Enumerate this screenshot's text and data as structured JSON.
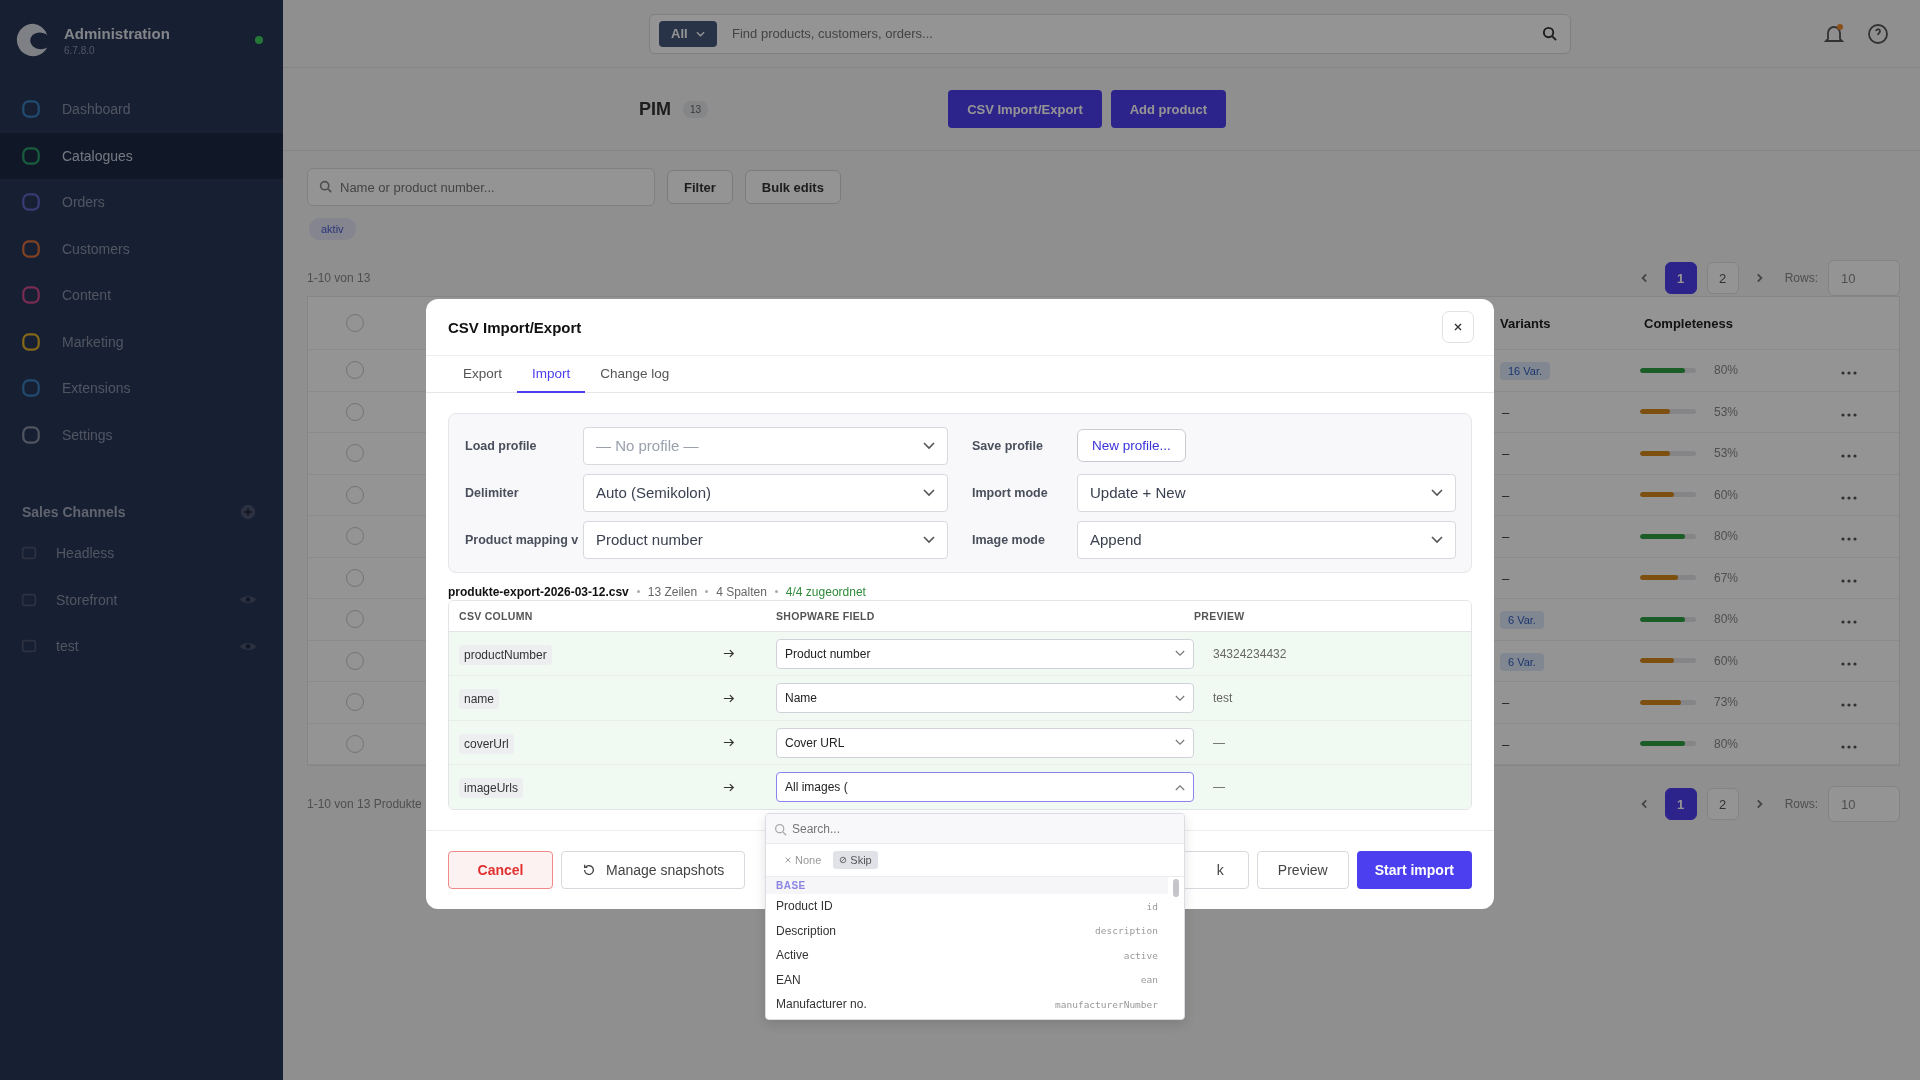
{
  "sidebar": {
    "brand": "Administration",
    "version": "6.7.8.0",
    "items": [
      {
        "label": "Dashboard",
        "selected": false
      },
      {
        "label": "Catalogues",
        "selected": true
      },
      {
        "label": "Orders",
        "selected": false
      },
      {
        "label": "Customers",
        "selected": false
      },
      {
        "label": "Content",
        "selected": false
      },
      {
        "label": "Marketing",
        "selected": false
      },
      {
        "label": "Extensions",
        "selected": false
      },
      {
        "label": "Settings",
        "selected": false
      }
    ],
    "sales_channels": {
      "title": "Sales Channels",
      "items": [
        {
          "label": "Headless",
          "show_eye": false
        },
        {
          "label": "Storefront",
          "show_eye": true
        },
        {
          "label": "test",
          "show_eye": true
        }
      ]
    }
  },
  "topbar": {
    "scope": "All",
    "search": {
      "placeholder": "Find products, customers, orders..."
    }
  },
  "header": {
    "title": "PIM",
    "count": "13",
    "buttons": [
      "CSV Import/Export",
      "Add product"
    ]
  },
  "toolbar": {
    "search": {
      "placeholder": "Name or product number..."
    },
    "buttons": [
      "Filter",
      "Bulk edits"
    ],
    "chips": [
      "aktiv"
    ]
  },
  "range_top": "1-10 von 13",
  "pagination": [
    {
      "pages": [
        {
          "label": "1",
          "selected": true
        },
        {
          "label": "2",
          "selected": false
        }
      ],
      "rows_label": "Rows:",
      "rows_value": "10"
    },
    {
      "pages": [
        {
          "label": "1",
          "selected": true
        },
        {
          "label": "2",
          "selected": false
        }
      ],
      "rows_label": "Rows:",
      "rows_value": "10"
    }
  ],
  "table": {
    "columns": [
      "Variants",
      "Completeness"
    ],
    "all_checked": false,
    "rows": [
      {
        "checked": false,
        "variants": "16 Var.",
        "level": 0.8,
        "reading": "80%"
      },
      {
        "checked": false,
        "variants": "–",
        "level": 0.53,
        "reading": "53%"
      },
      {
        "checked": false,
        "variants": "–",
        "level": 0.53,
        "reading": "53%"
      },
      {
        "checked": false,
        "variants": "–",
        "level": 0.6,
        "reading": "60%"
      },
      {
        "checked": false,
        "variants": "–",
        "level": 0.8,
        "reading": "80%"
      },
      {
        "checked": false,
        "variants": "–",
        "level": 0.67,
        "reading": "67%"
      },
      {
        "checked": false,
        "variants": "6 Var.",
        "level": 0.8,
        "reading": "80%"
      },
      {
        "checked": false,
        "variants": "6 Var.",
        "level": 0.6,
        "reading": "60%"
      },
      {
        "checked": false,
        "variants": "–",
        "level": 0.73,
        "reading": "73%"
      },
      {
        "checked": false,
        "variants": "–",
        "level": 0.8,
        "reading": "80%"
      }
    ]
  },
  "range_bottom": "1-10 von 13 Produkte",
  "modal": {
    "title": "CSV Import/Export",
    "tabs": [
      {
        "label": "Export",
        "selected": false
      },
      {
        "label": "Import",
        "selected": true
      },
      {
        "label": "Change log",
        "selected": false
      }
    ],
    "settings": [
      {
        "label": "Load profile",
        "kind": "select",
        "placeholder": "— No profile —"
      },
      {
        "label": "Save profile",
        "kind": "button",
        "value": "New profile..."
      },
      {
        "label": "Delimiter",
        "kind": "select",
        "value": "Auto (Semikolon)"
      },
      {
        "label": "Import mode",
        "kind": "select",
        "value": "Update + New"
      },
      {
        "label": "Product mapping v",
        "kind": "select",
        "value": "Product number"
      },
      {
        "label": "Image mode",
        "kind": "select",
        "value": "Append"
      }
    ],
    "file": {
      "name": "produkte-export-2026-03-12.csv",
      "rows": "13 Zeilen",
      "columns": "4 Spalten",
      "mapped": "4/4 zugeordnet"
    },
    "mapping": {
      "columns": [
        "CSV COLUMN",
        "SHOPWARE FIELD",
        "PREVIEW"
      ],
      "rows": [
        {
          "column": "productNumber",
          "field": "Product number",
          "preview": "34324234432",
          "open": false
        },
        {
          "column": "name",
          "field": "Name",
          "preview": "test",
          "open": false
        },
        {
          "column": "coverUrl",
          "field": "Cover URL",
          "preview": "—",
          "open": false
        },
        {
          "column": "imageUrls",
          "field": "All images (",
          "preview": "—",
          "open": true
        }
      ]
    },
    "dropdown": {
      "search": {
        "placeholder": "Search..."
      },
      "chips": [
        {
          "label": "None",
          "kind": "none",
          "selected": false
        },
        {
          "label": "Skip",
          "kind": "skip",
          "selected": true
        }
      ],
      "group": "BASE",
      "options": [
        {
          "label": "Product ID",
          "key": "id"
        },
        {
          "label": "Description",
          "key": "description"
        },
        {
          "label": "Active",
          "key": "active"
        },
        {
          "label": "EAN",
          "key": "ean"
        },
        {
          "label": "Manufacturer no.",
          "key": "manufacturerNumber"
        }
      ]
    },
    "footer": {
      "cancel": "Cancel",
      "snapshots": "Manage snapshots",
      "back_visible": "k",
      "preview": "Preview",
      "start": "Start import"
    }
  }
}
